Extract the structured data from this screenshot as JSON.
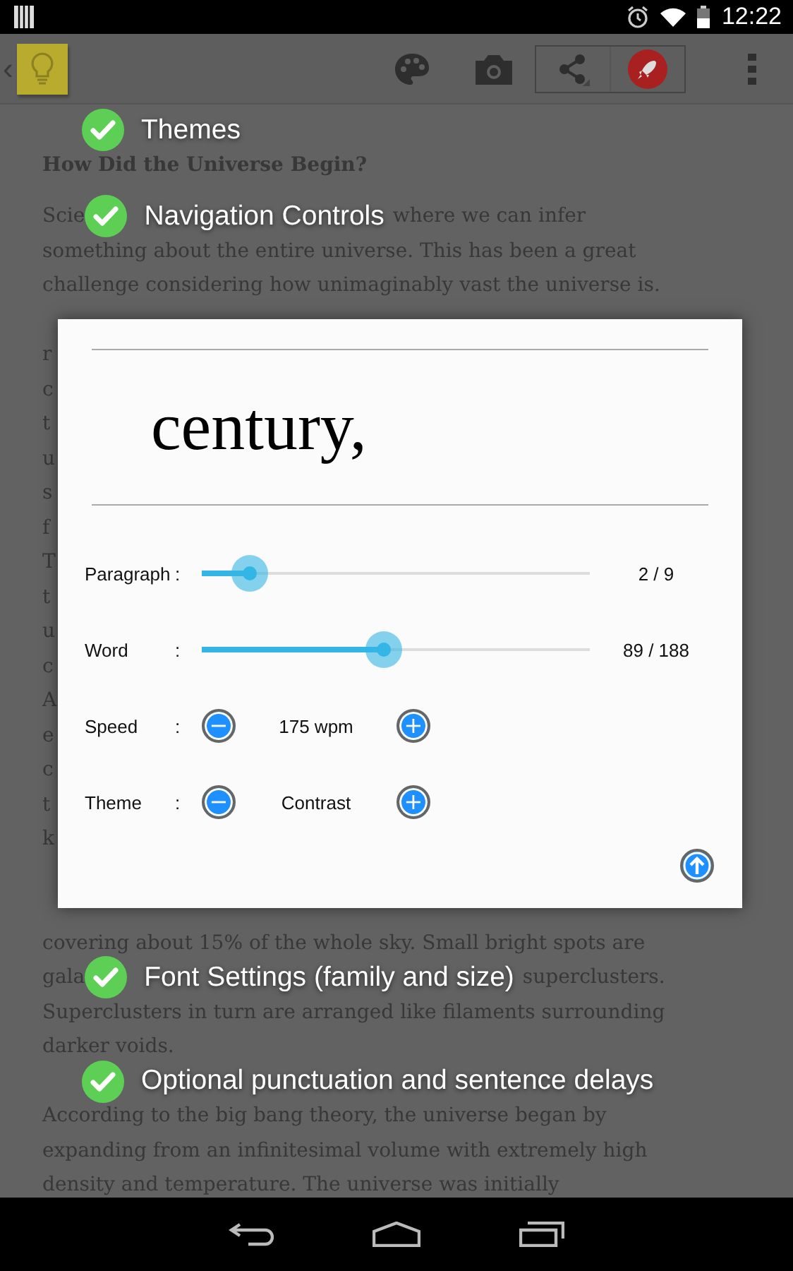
{
  "status_bar": {
    "time": "12:22"
  },
  "app_bar": {
    "back": "‹"
  },
  "article": {
    "rows": [
      {
        "kind": "callout",
        "callout": "Themes"
      },
      {
        "kind": "heading",
        "text": "How Did the Universe Begin?"
      },
      {
        "kind": "overlaid",
        "before": "Scie",
        "callout": "Navigation Controls",
        "after": "where we can infer"
      },
      {
        "kind": "text",
        "text": "something about the entire universe. This has been a great"
      },
      {
        "kind": "text",
        "text": "challenge considering how unimaginably vast the universe is."
      },
      {
        "kind": "covered"
      },
      {
        "kind": "text",
        "text": "r"
      },
      {
        "kind": "text",
        "text": "c"
      },
      {
        "kind": "text",
        "text": "t"
      },
      {
        "kind": "text",
        "text": "u"
      },
      {
        "kind": "text",
        "text": "s"
      },
      {
        "kind": "text",
        "text": "f"
      },
      {
        "kind": "text",
        "text": "T"
      },
      {
        "kind": "text",
        "text": "t"
      },
      {
        "kind": "text",
        "text": "u"
      },
      {
        "kind": "text",
        "text": "c"
      },
      {
        "kind": "text",
        "text": "A"
      },
      {
        "kind": "text",
        "text": "e"
      },
      {
        "kind": "text",
        "text": "c"
      },
      {
        "kind": "text",
        "text": "t"
      },
      {
        "kind": "text",
        "text": "k"
      },
      {
        "kind": "covered"
      },
      {
        "kind": "covered"
      },
      {
        "kind": "text",
        "text": "covering about 15% of the whole sky. Small bright spots are"
      },
      {
        "kind": "overlaid",
        "before": "gala",
        "callout": "Font Settings (family and size)",
        "after": "superclusters."
      },
      {
        "kind": "text",
        "text": "Superclusters in turn are arranged like filaments surrounding"
      },
      {
        "kind": "text",
        "text": "darker voids."
      },
      {
        "kind": "callout",
        "callout": "Optional punctuation and sentence delays"
      },
      {
        "kind": "text",
        "text": "According to the big bang theory, the universe began by"
      },
      {
        "kind": "text",
        "text": "expanding from an infinitesimal volume with extremely high"
      },
      {
        "kind": "text",
        "text": "density and temperature. The universe was initially"
      }
    ]
  },
  "dialog": {
    "word": "century,",
    "sliders": [
      {
        "label": "Paragraph",
        "colon": ":",
        "level": 0.124,
        "reading": "2 / 9"
      },
      {
        "label": "Word",
        "colon": ":",
        "level": 0.47,
        "reading": "89 / 188"
      }
    ],
    "steppers": [
      {
        "label": "Speed",
        "colon": ":",
        "minus": "−",
        "value": "175 wpm",
        "plus": "+"
      },
      {
        "label": "Theme",
        "colon": ":",
        "minus": "−",
        "value": "Contrast",
        "plus": "+"
      }
    ]
  }
}
